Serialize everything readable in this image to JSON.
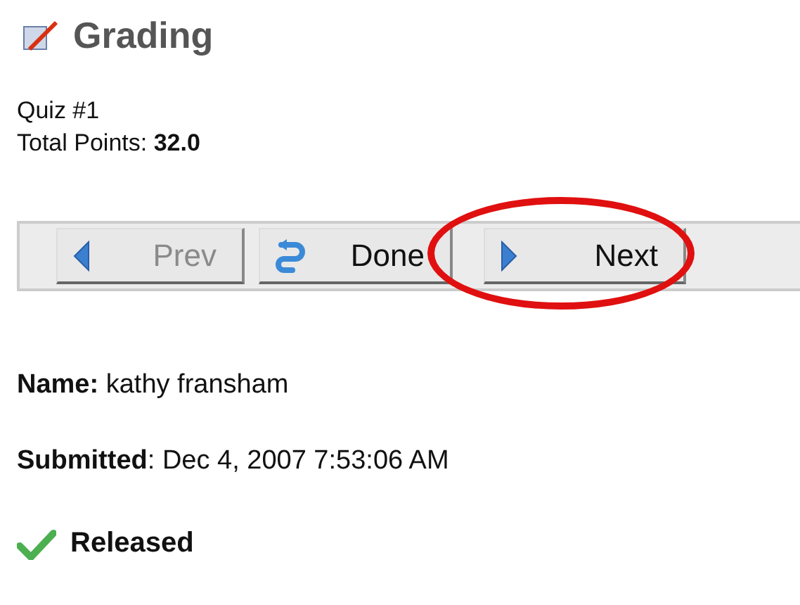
{
  "header": {
    "title": "Grading"
  },
  "quiz": {
    "name": "Quiz #1",
    "points_label": "Total Points:",
    "points": "32.0"
  },
  "buttons": [
    {
      "kind": "prev",
      "label": "Prev",
      "disabled": true,
      "circled": false
    },
    {
      "kind": "done",
      "label": "Done",
      "disabled": false,
      "circled": false
    },
    {
      "kind": "next",
      "label": "Next",
      "disabled": false,
      "circled": true
    }
  ],
  "details": [
    {
      "label": "Name:",
      "value": "kathy fransham"
    },
    {
      "label": "Submitted",
      "value": ": Dec 4, 2007 7:53:06 AM"
    }
  ],
  "status": {
    "label": "Released",
    "released": true
  }
}
